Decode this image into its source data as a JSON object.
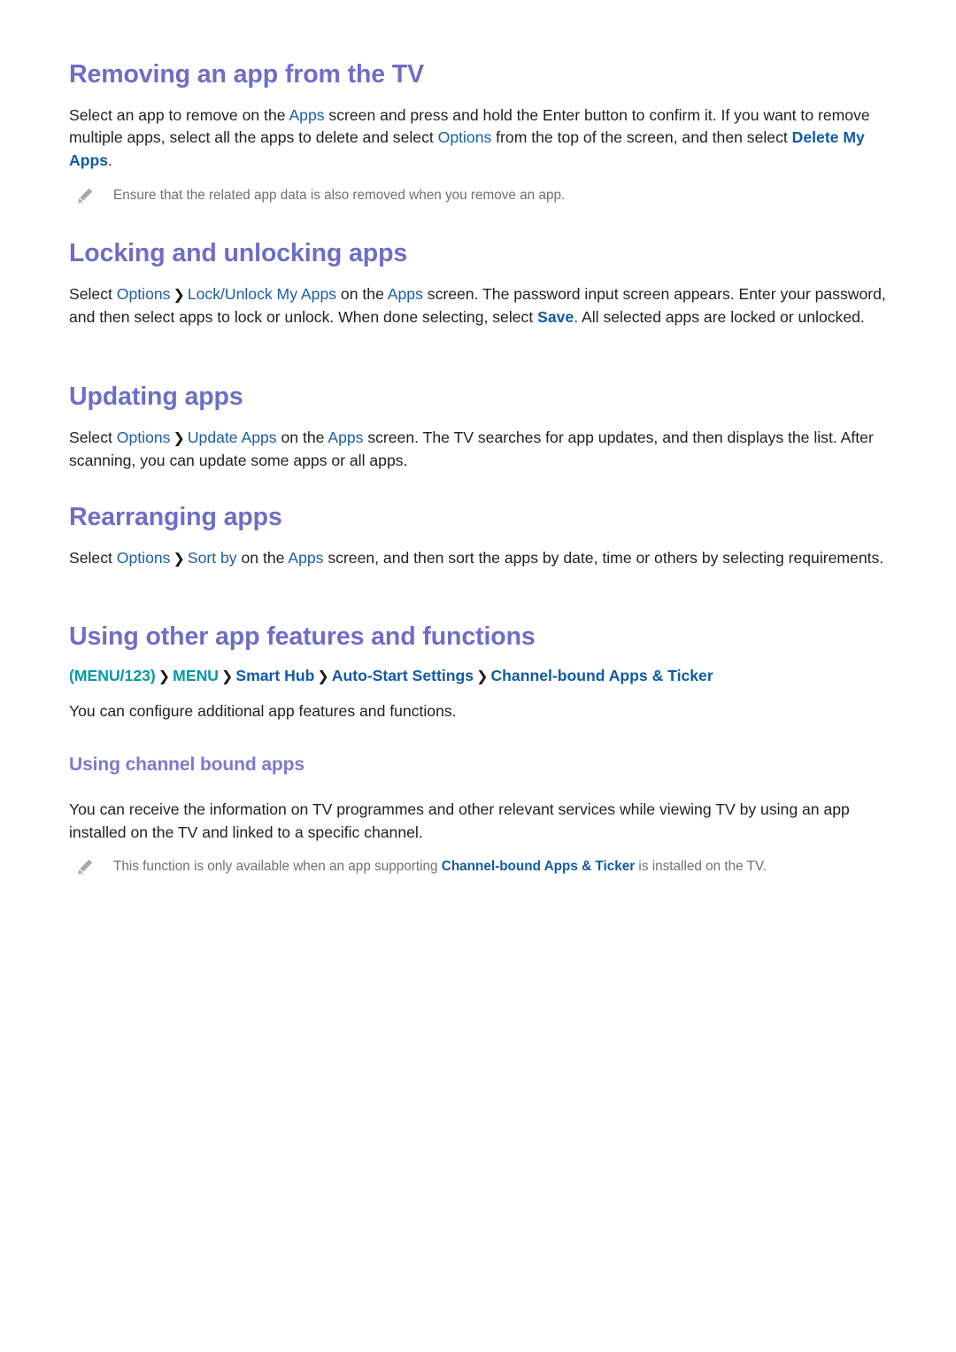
{
  "page": {
    "background": "#ffffff",
    "heading_color": "#6e6ec8",
    "link_color": "#1a5ea6",
    "link_bold_color": "#105ba4",
    "teal_color": "#009aa6",
    "note_color": "#6f6f79",
    "body_color": "#231f20"
  },
  "sections": {
    "removing": {
      "title": "Removing an app from the TV",
      "para": {
        "t1": "Select an app to remove on the ",
        "k1": "Apps",
        "t2": " screen and press and hold the Enter button to confirm it. If you want to remove multiple apps, select all the apps to delete and select ",
        "k2": "Options",
        "t3": " from the top of the screen, and then select ",
        "k3": "Delete My Apps",
        "t4": "."
      },
      "note": {
        "icon": "pencil-icon",
        "text": "Ensure that the related app data is also removed when you remove an app."
      }
    },
    "locking": {
      "title": "Locking and unlocking apps",
      "para": {
        "t1": "Select ",
        "k1": "Options",
        "sep1": "❯",
        "k2": "Lock/Unlock My Apps",
        "t2": " on the ",
        "k3": "Apps",
        "t3": " screen. The password input screen appears. Enter your password, and then select apps to lock or unlock. When done selecting, select ",
        "k4": "Save",
        "t4": ". All selected apps are locked or unlocked."
      }
    },
    "updating": {
      "title": "Updating apps",
      "para": {
        "t1": "Select ",
        "k1": "Options",
        "sep1": "❯",
        "k2": "Update Apps",
        "t2": " on the ",
        "k3": "Apps",
        "t3": " screen. The TV searches for app updates, and then displays the list. After scanning, you can update some apps or all apps."
      }
    },
    "rearranging": {
      "title": "Rearranging apps",
      "para": {
        "t1": "Select ",
        "k1": "Options",
        "sep1": "❯",
        "k2": "Sort by",
        "t2": " on the ",
        "k3": "Apps",
        "t3": " screen, and then sort the apps by date, time or others by selecting requirements."
      }
    },
    "other_features": {
      "title": "Using other app features and functions",
      "breadcrumb": {
        "items": [
          {
            "label": "(MENU/123)",
            "style": "teal"
          },
          {
            "label": "MENU",
            "style": "teal"
          },
          {
            "label": "Smart Hub",
            "style": "blue"
          },
          {
            "label": "Auto-Start Settings",
            "style": "blue"
          },
          {
            "label": "Channel-bound Apps & Ticker",
            "style": "blue"
          }
        ],
        "separator": "❯"
      },
      "para": "You can configure additional app features and functions."
    },
    "channel_bound": {
      "title": "Using channel bound apps",
      "para": "You can receive the information on TV programmes and other relevant services while viewing TV by using an app installed on the TV and linked to a specific channel.",
      "note": {
        "icon": "pencil-icon",
        "t1": "This function is only available when an app supporting ",
        "k1": "Channel-bound Apps & Ticker",
        "t2": " is installed on the TV."
      }
    }
  }
}
